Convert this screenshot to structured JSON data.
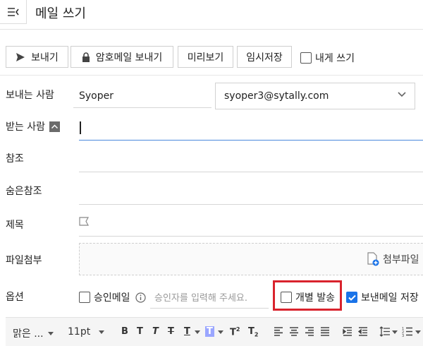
{
  "header": {
    "title": "메일 쓰기"
  },
  "toolbar": {
    "send_label": "보내기",
    "secure_send_label": "암호메일 보내기",
    "preview_label": "미리보기",
    "draft_label": "임시저장",
    "self_label": "내게 쓰기"
  },
  "form": {
    "sender_label": "보내는 사람",
    "sender_name": "Syoper",
    "sender_email": "syoper3@sytally.com",
    "to_label": "받는 사람",
    "cc_label": "참조",
    "bcc_label": "숨은참조",
    "subject_label": "제목",
    "attach_label": "파일첨부",
    "attach_action": "첨부파일",
    "options_label": "옵션"
  },
  "options": {
    "approval_label": "승인메일",
    "approver_placeholder": "승인자를 입력해 주세요.",
    "individual_label": "개별 발송",
    "save_sent_label": "보낸메일 저장"
  },
  "editor": {
    "font_name": "맑은 ...",
    "font_size": "11pt"
  },
  "colors": {
    "accent": "#1a73e8",
    "highlight": "#d9232d"
  }
}
